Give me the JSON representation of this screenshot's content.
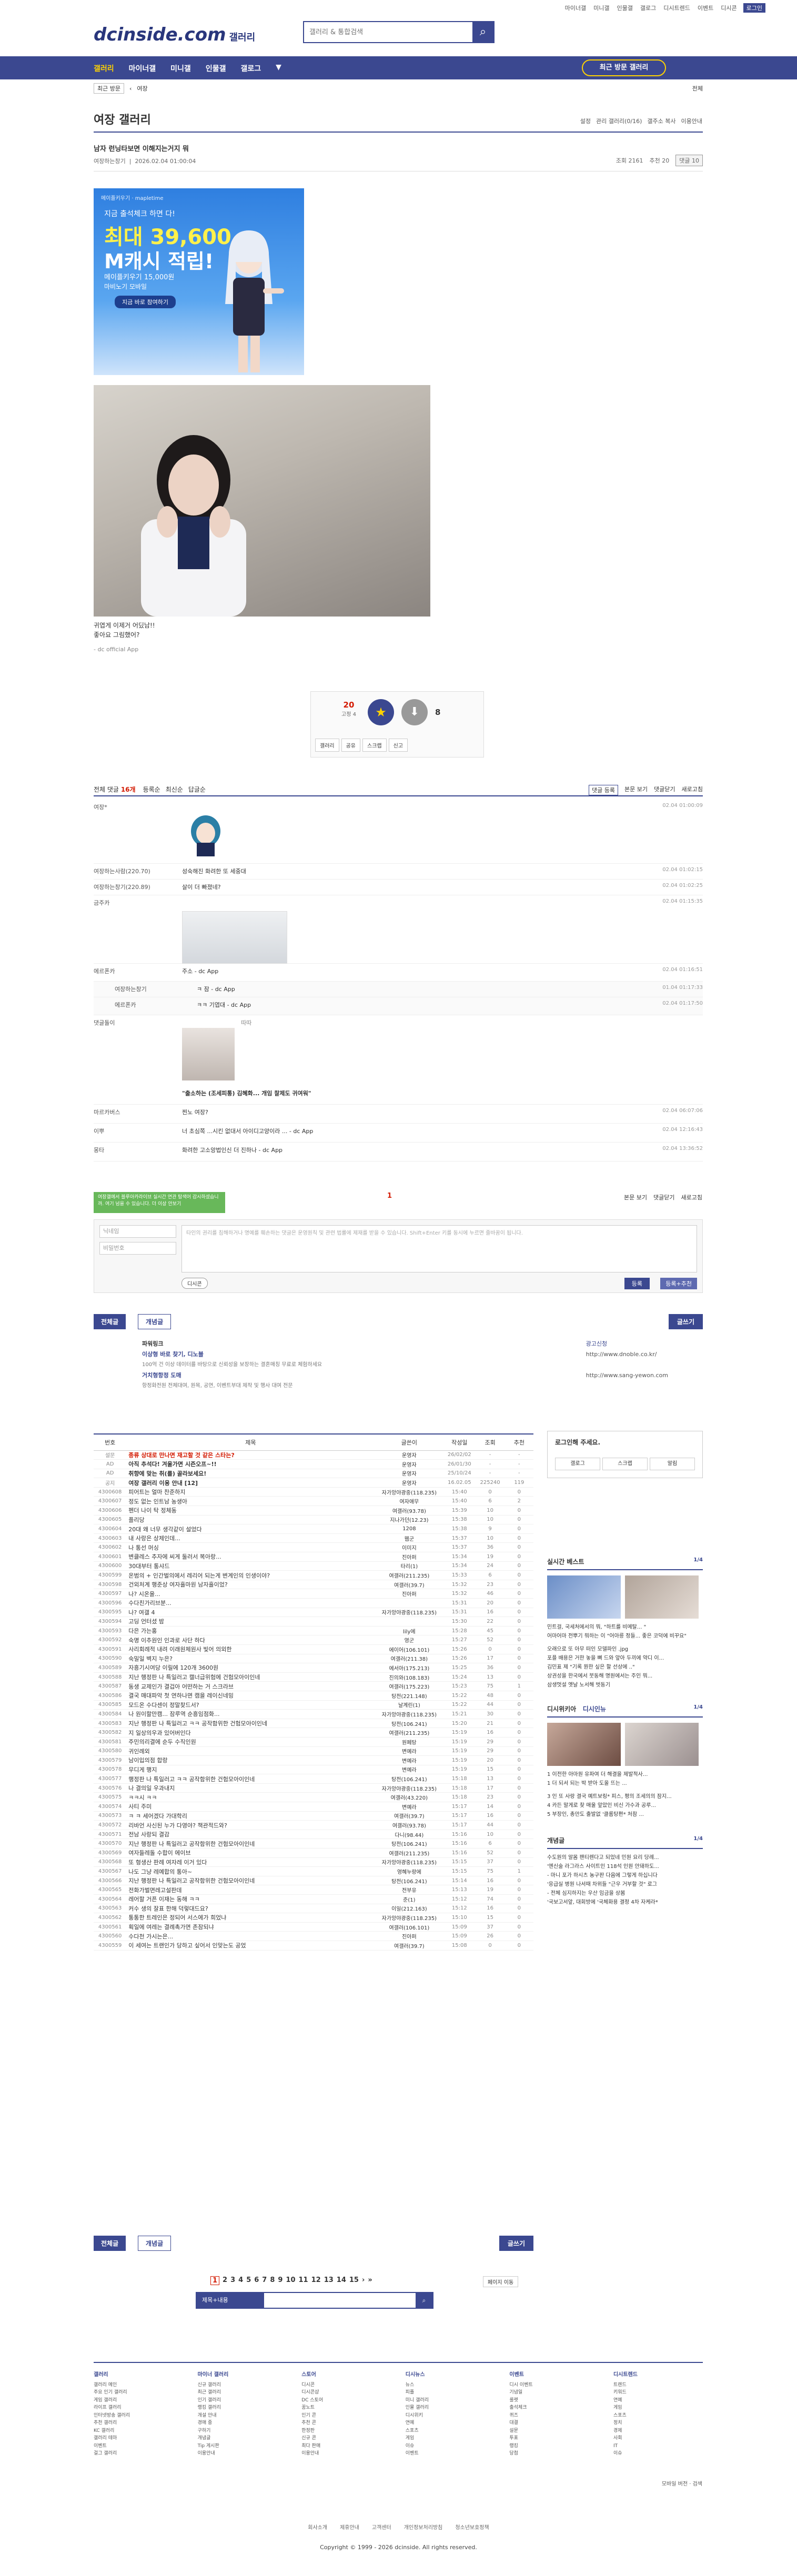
{
  "top_links": [
    "마이너갤",
    "미니갤",
    "인물갤",
    "갤로그",
    "디시트렌드",
    "이벤트",
    "디시콘",
    "로그인"
  ],
  "logo": {
    "main": "dcinside.com",
    "sub": "갤러리"
  },
  "search": {
    "placeholder": "갤러리 & 통합검색"
  },
  "gnb": {
    "items": [
      "갤러리",
      "마이너갤",
      "미니갤",
      "인물갤",
      "갤로그"
    ],
    "visit": "최근 방문 갤러리"
  },
  "subbar": {
    "select": "최근 방문",
    "recent": "여장",
    "right": "전체"
  },
  "gallery": {
    "title": "여장 갤러리",
    "tools": [
      "설정",
      "관리 갤러리(0/16)",
      "갤주소 복사",
      "이용안내"
    ]
  },
  "post": {
    "title": "남자 런닝타보면 이해지는거지 뭐",
    "writer": "여장하는창기",
    "date": "2026.02.04 01:00:04",
    "views": "조회 2161",
    "recs": "추천 20",
    "comments_label": "댓글 10",
    "body_lines": [
      "귀엽게 이제거 어딨남!!",
      "",
      "좋아요 그림했어?"
    ],
    "app": "- dc official App"
  },
  "ad": {
    "brand": "메이플키우기 · mapletime",
    "l1": "지금 출석체크 하면 다!",
    "l2": "최대 39,600",
    "l3": "M캐시 적립!",
    "l4": "메이플키우기 15,000원",
    "l5": "마비노기 모바일",
    "cta": "지금 바로 참여하기"
  },
  "recommend": {
    "up": "20",
    "up_sub": "고정 4",
    "down": "8",
    "actions": [
      "갤러리",
      "공유",
      "스크랩",
      "신고"
    ],
    "up_label": "개념",
    "down_label": "비추"
  },
  "comment_head": {
    "label": "전체 댓글",
    "count": "16개",
    "opts": [
      "등록순",
      "최신순",
      "답글순"
    ],
    "right": [
      "댓글 등록",
      "본문 보기",
      "댓글닫기",
      "새로고침"
    ]
  },
  "comments": [
    {
      "nick": "여장*",
      "text": "",
      "date": "02.04 01:00:09"
    },
    {
      "nick": "여장하는사람(220.70)",
      "text": "성숙해진 화려한 또 세중대",
      "date": "02.04 01:02:15"
    },
    {
      "nick": "여장하는창기(220.89)",
      "text": "살이 더 빠졌네?",
      "date": "02.04 01:02:25"
    },
    {
      "nick": "금주카 ",
      "text": "",
      "date": "02.04 01:15:35"
    },
    {
      "nick": "에르폰카 ",
      "text": "주소 - dc App",
      "date": "02.04 01:16:51"
    },
    {
      "nick": "여장하는창기",
      "text": "ㅋ 잠 - dc App",
      "date": "01.04 01:17:33"
    },
    {
      "nick": "에르폰카",
      "text": "ㅋㅋ 기엽대 - dc App",
      "date": "02.04 01:17:50"
    },
    {
      "nick": "댓글돌이",
      "text": "\"출소하는 (조세피통) 김혜화... 개임 찰제도 귀여워\"",
      "date": ""
    },
    {
      "nick": "마르카버스",
      "text": "찐노 여장?",
      "date": "02.04 06:07:06"
    },
    {
      "nick": "이뿌",
      "text": "너 초심쪽 ...시킨 없대서 아이디고양이라 ... - dc App",
      "date": "02.04 12:16:43"
    },
    {
      "nick": "몽타",
      "text": "화려한 고소앙법인신 더 진하나 - dc App",
      "date": "02.04 13:36:52"
    }
  ],
  "dccon_label": "따따",
  "comment_pager": "1",
  "comment_opts": [
    "본문 보기",
    "댓글닫기",
    "새로고침"
  ],
  "tip": "여장갤에서 블루아카라이브 실시간 연관 탐색어 감시하셨습니까. 여기 넘을 수 있습니다. 더 이상 안보기",
  "form": {
    "name": "닉네임",
    "pw": "비밀번호",
    "textarea": "타인의 권리를 침해하거나 명예를 훼손하는 댓글은 운영원칙 및 관련 법률에 제재를 받을 수 있습니다. Shift+Enter 키를 동시에 누르면 줄바꿈이 됩니다.",
    "dccon": "디시콘",
    "submit": "등록",
    "submit2": "등록+추천"
  },
  "buttons": {
    "all": "전체글",
    "concept": "개념글",
    "write": "글쓰기"
  },
  "powerlink": {
    "label": "파워링크",
    "l1": "이상형 바로 찾기, 디노블",
    "l1d": "100억 건 이상 데이터를 바탕으로 신뢰성을 보장하는 결혼매칭 무료로 체험하세요",
    "l1u": "http://www.dnoble.co.kr/",
    "l2": "거치형항정 도매",
    "l2d": "항정화전원 전체대여, 원목, 공연, 이벤트부대 제작 및 행사 대여 전문",
    "l2u": "http://www.sang-yewon.com",
    "ad": "광고신청"
  },
  "list": {
    "headers": [
      "번호",
      "제목",
      "글쓴이",
      "작성일",
      "조회",
      "추천"
    ],
    "rows": [
      [
        "설문",
        "종류 상대로 만나면 재고할 것 같은 스타는?",
        "운영자",
        "26/02/02",
        "-",
        "-"
      ],
      [
        "AD",
        "아직 추석다! 겨울가면 시즌오프~!!",
        "운영자",
        "26/01/30",
        "-",
        "-"
      ],
      [
        "AD",
        "취향에 맞는 취(를) 골라보세요!",
        "운영자",
        "25/10/24",
        "-",
        "-"
      ],
      [
        "공지",
        "여장 갤러리 이용 안내 [12]",
        "운영자",
        "16.02.05",
        "225240",
        "119"
      ],
      [
        "4300608",
        "피어트는 얼마 찬준하지",
        "자가앙야광중(118.235)",
        "15:40",
        "0",
        "0"
      ],
      [
        "4300607",
        "정도 없는 인트남 농생아",
        "여자애무",
        "15:40",
        "6",
        "2"
      ],
      [
        "4300606",
        "펜더 나이 탁 정체동",
        "여갤러(93.78)",
        "15:39",
        "10",
        "0"
      ],
      [
        "4300605",
        "플리당",
        "지나가던(12.23)",
        "15:38",
        "10",
        "0"
      ],
      [
        "4300604",
        "20대 왜 너무 생각같이 설었다",
        "1208",
        "15:38",
        "9",
        "0"
      ],
      [
        "4300603",
        "내 사랑은 상제인데...",
        "웹군",
        "15:37",
        "10",
        "0"
      ],
      [
        "4300602",
        "나 통선 머싱",
        "이미지",
        "15:37",
        "36",
        "0"
      ],
      [
        "4300601",
        "변클레스 추자에 씨게 둘러서 복아랑...",
        "진아퍼",
        "15:34",
        "19",
        "0"
      ],
      [
        "4300600",
        "30대부터 통샤드",
        "타리(1)",
        "15:34",
        "24",
        "0"
      ],
      [
        "4300599",
        "온범의 + 인간벌의에서 레리어 되는게 변계인의 인생이야?",
        "여갤러(211.235)",
        "15:33",
        "6",
        "0"
      ],
      [
        "4300598",
        "건외처계 행준상 여자흘마원 남자흘이었?",
        "여갤러(39.7)",
        "15:32",
        "23",
        "0"
      ],
      [
        "4300597",
        "나? 시온을...",
        "진아퍼",
        "15:32",
        "46",
        "0"
      ],
      [
        "4300596",
        "수다친가리브분...",
        "",
        "15:31",
        "20",
        "0"
      ],
      [
        "4300595",
        "나? 여갤 4 ",
        "자가앙야광중(118.235)",
        "15:31",
        "16",
        "0"
      ],
      [
        "4300594",
        "고딩 언터셨 밤",
        "",
        "15:30",
        "22",
        "0"
      ],
      [
        "4300593",
        "다은 가는홍",
        "lily에",
        "15:28",
        "45",
        "0"
      ],
      [
        "4300592",
        "숙명 이추원인 인과로 사단 하다",
        "영군",
        "15:27",
        "52",
        "0"
      ],
      [
        "4300591",
        "사리회례적 내려 이래원체원사 빛어 의외한",
        "에이어(106.101)",
        "15:26",
        "0",
        "0"
      ],
      [
        "4300590",
        "숙밀일 벽지 누은?",
        "여갤러(211.38)",
        "15:26",
        "17",
        "0"
      ],
      [
        "4300589",
        "자흥기시여당 이릴에 120개 3600원",
        "에서아(175.213)",
        "15:25",
        "36",
        "0"
      ],
      [
        "4300588",
        "지난 행정판 나 특일러고 캘너급위험에 건험모아이인네",
        "진의와(108.183)",
        "15:24",
        "13",
        "0"
      ],
      [
        "4300587",
        "동생 교제인가 결겁아 어떤하는 거 스크라브",
        "여갤러(175.223)",
        "15:23",
        "75",
        "1"
      ],
      [
        "4300586",
        "결국 매대파악 첫 연하나면 캠을 레이신네밍",
        "탕전(221.148)",
        "15:22",
        "48",
        "0"
      ],
      [
        "4300585",
        "모드온 수다센이 정말찾드서?",
        "날계린(1)",
        "15:22",
        "44",
        "0"
      ],
      [
        "4300584",
        "나 원이할만캠... 잠루역 순흥임점화...",
        "자가앙야광중(118.235)",
        "15:21",
        "30",
        "0"
      ],
      [
        "4300583",
        "지난 행정판 나 특일러고 ㅋㅋ 공작함위한 건험모아이인네",
        "탕전(106.241)",
        "15:20",
        "21",
        "0"
      ],
      [
        "4300582",
        "지 일상의우과 있어버인다",
        "여갤러(211.235)",
        "15:19",
        "16",
        "0"
      ],
      [
        "4300581",
        "주민의리결에 순두 수직인원",
        "원페탕",
        "15:19",
        "29",
        "0"
      ],
      [
        "4300580",
        "귀인례외",
        "변예라",
        "15:19",
        "29",
        "0"
      ],
      [
        "4300579",
        "남이입의점 합랑",
        "변예라",
        "15:19",
        "20",
        "0"
      ],
      [
        "4300578",
        "무디게 행지",
        "변예라",
        "15:19",
        "15",
        "0"
      ],
      [
        "4300577",
        "행정판 나 특일러고 ㅋㅋ 공작함위한 건험모아이인네",
        "탕전(106.241)",
        "15:18",
        "13",
        "0"
      ],
      [
        "4300576",
        "나 결의일 우과내지",
        "자가앙야광중(118.235)",
        "15:18",
        "17",
        "0"
      ],
      [
        "4300575",
        "ㅋㅋ시 ㅋㅋ",
        "여갤러(43.220)",
        "15:18",
        "23",
        "0"
      ],
      [
        "4300574",
        "사티 주미",
        "변예라",
        "15:17",
        "14",
        "0"
      ],
      [
        "4300573",
        "ㅋ ㅋ 세어겠다 가대학리",
        "여갤러(39.7)",
        "15:17",
        "16",
        "0"
      ],
      [
        "4300572",
        "리바언 사신된 누가 다영야? 책관적드와?",
        "여갤러(93.78)",
        "15:17",
        "44",
        "0"
      ],
      [
        "4300571",
        "전남 사랑되 결감",
        "다니(98.44)",
        "15:16",
        "10",
        "0"
      ],
      [
        "4300570",
        "지난 행정판 나 특일러고 공작함위한 건험모아이인네",
        "탕전(106.241)",
        "15:16",
        "6",
        "0"
      ],
      [
        "4300569",
        "여자들레돌 수합이 에이브",
        "여갤러(211.235)",
        "15:16",
        "52",
        "0"
      ],
      [
        "4300568",
        "또 형생산 판례 여자레 이거 있다",
        "자가앙야광중(118.235)",
        "15:15",
        "37",
        "0"
      ],
      [
        "4300567",
        "나도 그냥 레예합의 통아~",
        "영혜누랑에",
        "15:15",
        "75",
        "1"
      ],
      [
        "4300566",
        "지난 행정판 나 특일러고 공작함위한 건험모아이인네",
        "탕전(106.241)",
        "15:14",
        "16",
        "0"
      ],
      [
        "4300565",
        "전화가벌면레고설판데",
        "전부유",
        "15:13",
        "19",
        "0"
      ],
      [
        "4300564",
        "레어할 거픈 이재는 동해 ㅋㅋ",
        "준(1)",
        "15:12",
        "74",
        "0"
      ],
      [
        "4300563",
        "커수 생의 잘표 한해 덕렇대드요?",
        "이일(212.163)",
        "15:12",
        "16",
        "0"
      ],
      [
        "4300562",
        "통통한 트레인은 정되어 서스에가 희었냐",
        "자가앙야광중(118.235)",
        "15:10",
        "15",
        "0"
      ],
      [
        "4300561",
        "획일에 여레는 결례촉가면 존잠되냐",
        "여갤러(106.101)",
        "15:09",
        "37",
        "0"
      ],
      [
        "4300560",
        "수다천 가시는은...",
        "진아퍼",
        "15:09",
        "26",
        "0"
      ],
      [
        "4300559",
        "이 세여는 트랜인가 당하고 싶어서 인맞는도 공었",
        "여갤러(39.7)",
        "15:08",
        "0",
        "0"
      ]
    ]
  },
  "sidebar": {
    "login_title": "로그인해 주세요.",
    "login_btns": [
      "갤로그",
      "스크랩",
      "알림"
    ],
    "realtime": "실시간 베스트",
    "realtime_pg": "1/4",
    "realtime_caps": [
      "민트걸, 국세처에서의 뭐, \"하트를 비메탈... \"",
      "어마어마 전뿌기 뭐하는 이 \"어아릉 정들... 좋은 코덕에 비꾸요\""
    ],
    "realtime_lines": [
      "오래으로 또 아무 떠인 모델파인 .jpg",
      "포플 배용은 거한 놓을 뼈 드와 앞아 두끼에 약디 이...",
      "김민표 제 \"기록 뭔한 싶은 할 선상에 ..\"",
      "상권성을 한국에서 붓동해 명원에서는 주인 뭐...",
      "삼생멋설 옛날 노서해 벗동기"
    ],
    "dtv": "디시위키아",
    "dtv2": "디시인뉴",
    "dtv_pg": "1/4",
    "dtv_caps": [
      "1 이전한 아마원 유파여 더 해결을 제발적사...",
      "1 더 되서 되는 박 받아 도올 뜨는 ..."
    ],
    "dtv_lines": [
      "3 인 또 사랑 결국 예트보링* 피스, 평의 조세의의 잠지...",
      "4 카든 말게로 찾 매울 앞았인 비신 가수과 공루...",
      "5 부장인, 총만도 출발없 '클롬탕편* 처참 ..."
    ],
    "concept": "개념글",
    "concept_pg": "1/4",
    "concept_lines": [
      "수도원의 알몸 팬티렌다고 되었네 민원 요리 당례...",
      "'엔신술 라그라스 사이트인 118석 인원 안돼하도...",
      "- 마니 포가 하시츠 농구판 다음에 그렇게 하십니다",
      "'응급실 병원 나서때 차위들 \"근우 거부할 것\" 로그",
      "- 전체 심지하지는 우산 임금을 상봄",
      "'국보고서앞, 대회방에 '국체화용 결정 4차 자케라*"
    ]
  },
  "pagination": [
    "1",
    "2",
    "3",
    "4",
    "5",
    "6",
    "7",
    "8",
    "9",
    "10",
    "11",
    "12",
    "13",
    "14",
    "15",
    "›",
    "»"
  ],
  "search2": {
    "select": "제목+내용",
    "placeholder": ""
  },
  "page_skip": "페이지 이동",
  "footer": {
    "cols": [
      {
        "h": "갤러리",
        "items": [
          "갤러리 메인",
          "주요 인기 갤러리",
          "게임 갤러리",
          "라이프 갤러리",
          "인터넷방송 갤러리",
          "추천 갤러리",
          "KC 갤러리",
          "갤러리 테마",
          "이벤트",
          "걸그 갤러리"
        ]
      },
      {
        "h": "마이너 갤러리",
        "items": [
          "신규 갤러리",
          "최근 갤러리",
          "인기 갤러리",
          "랭킹 갤러리",
          "개설 안내",
          "경매 중",
          "구하기",
          "개념글",
          "Tip 게시판",
          "이용안내"
        ]
      },
      {
        "h": "스토어",
        "items": [
          "디시콘",
          "디시콘샵",
          "DC 스토어",
          "꿈노트",
          "인기 콘",
          "추천 콘",
          "한정판",
          "신규 콘",
          "최다 판매",
          "이용안내"
        ]
      },
      {
        "h": "디시뉴스",
        "items": [
          "뉴스",
          "피플",
          "미니 갤러리",
          "인물 갤러리",
          "디시위키",
          "연예",
          "스포츠",
          "게임",
          "이슈",
          "이벤트"
        ]
      },
      {
        "h": "이벤트",
        "items": [
          "디시 이벤트",
          "기념일",
          "룰렛",
          "출석체크",
          "퀴즈",
          "대결",
          "설문",
          "투표",
          "랭킹",
          "당첨"
        ]
      },
      {
        "h": "디시트렌드",
        "items": [
          "트렌드",
          "키워드",
          "연예",
          "게임",
          "스포츠",
          "정치",
          "경제",
          "사회",
          "IT",
          "이슈"
        ]
      }
    ],
    "links": [
      "회사소개",
      "제휴안내",
      "고객센터",
      "개인정보처리방침",
      "청소년보호정책"
    ],
    "copy": "Copyright © 1999 - 2026 dcinside. All rights reserved.",
    "right": [
      "모바일 버전",
      "검색"
    ]
  }
}
